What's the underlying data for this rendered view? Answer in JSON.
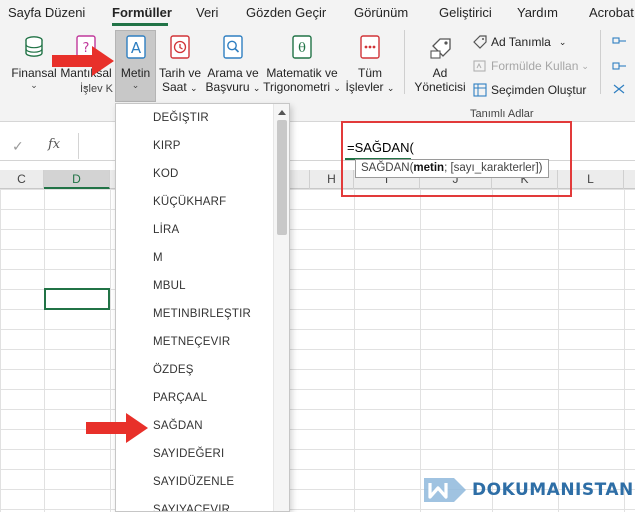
{
  "tabs": [
    {
      "label": "Sayfa Düzeni",
      "active": false
    },
    {
      "label": "Formüller",
      "active": true
    },
    {
      "label": "Veri",
      "active": false
    },
    {
      "label": "Gözden Geçir",
      "active": false
    },
    {
      "label": "Görünüm",
      "active": false
    },
    {
      "label": "Geliştirici",
      "active": false
    },
    {
      "label": "Yardım",
      "active": false
    },
    {
      "label": "Acrobat",
      "active": false
    }
  ],
  "ribbon": {
    "buttons": [
      {
        "line1": "Finansal",
        "line2": "",
        "icon": "database-icon"
      },
      {
        "line1": "Mantıksal",
        "line2": "",
        "icon": "question-icon"
      },
      {
        "line1": "Metin",
        "line2": "",
        "icon": "text-a-icon"
      },
      {
        "line1": "Tarih ve",
        "line2": "Saat",
        "icon": "clock-icon"
      },
      {
        "line1": "Arama ve",
        "line2": "Başvuru",
        "icon": "search-icon"
      },
      {
        "line1": "Matematik ve",
        "line2": "Trigonometri",
        "icon": "theta-icon"
      },
      {
        "line1": "Tüm",
        "line2": "İşlevler",
        "icon": "more-icon"
      },
      {
        "line1": "Ad",
        "line2": "Yöneticisi",
        "icon": "name-manager-icon"
      }
    ],
    "group_islev": "İşlev K",
    "group_tanimli": "Tanımlı Adlar",
    "ad_tanimla": "Ad Tanımla",
    "formulde_kullan": "Formülde Kullan",
    "secimden_olustur": "Seçimden Oluştur"
  },
  "formula_bar": {
    "cancel_glyph": "✓",
    "fx": "fx"
  },
  "columns": [
    "C",
    "D",
    "H",
    "I",
    "J",
    "K",
    "L"
  ],
  "selected_column": "D",
  "menu_items": [
    "DEĞIŞTIR",
    "KIRP",
    "KOD",
    "KÜÇÜKHARF",
    "LİRA",
    "M",
    "MBUL",
    "METINBIRLEŞTIR",
    "METNEÇEVIR",
    "ÖZDEŞ",
    "PARÇAAL",
    "SAĞDAN",
    "SAYIDEĞERI",
    "SAYIDÜZENLE",
    "SAYIYAÇEVIR"
  ],
  "highlighted_item": "SAĞDAN",
  "formula": {
    "text": "=SAĞDAN(",
    "tooltip_fn": "SAĞDAN(",
    "tooltip_bold": "metin",
    "tooltip_rest": "; [sayı_karakterler])"
  },
  "watermark": "DOKUMANISTAN",
  "colors": {
    "excel_green": "#217346",
    "highlight_red": "#e23a3a",
    "arrow_red": "#e8302a"
  }
}
